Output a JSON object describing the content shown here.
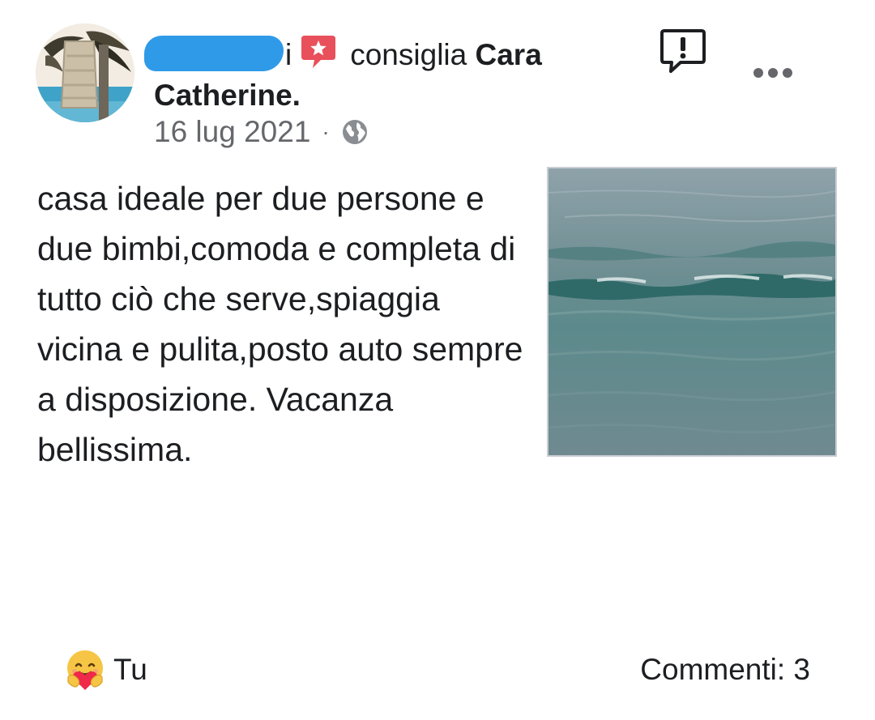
{
  "post": {
    "author_suffix": "i",
    "action_text": "consiglia",
    "page_name_part1": "Cara",
    "page_name_part2": "Catherine.",
    "date": "16 lug 2021",
    "separator": "·",
    "audience_icon": "globe-icon",
    "recommend_icon": "recommend-star-icon",
    "body": "casa ideale per due persone e due bimbi,comoda e completa di tutto ciò che serve,spiaggia vicina e pulita,posto auto sempre a disposizione. Vacanza bellissima.",
    "photo_icon": "sea-photo"
  },
  "actions": {
    "report_icon": "report-icon",
    "more_icon": "more-icon"
  },
  "footer": {
    "reaction_icon": "care-reaction-icon",
    "reaction_label": "Tu",
    "comments_label": "Commenti: 3"
  },
  "colors": {
    "text": "#1c1e21",
    "muted": "#65676b",
    "recommend_red": "#e8505b",
    "redaction_blue": "#2f9ae8"
  }
}
